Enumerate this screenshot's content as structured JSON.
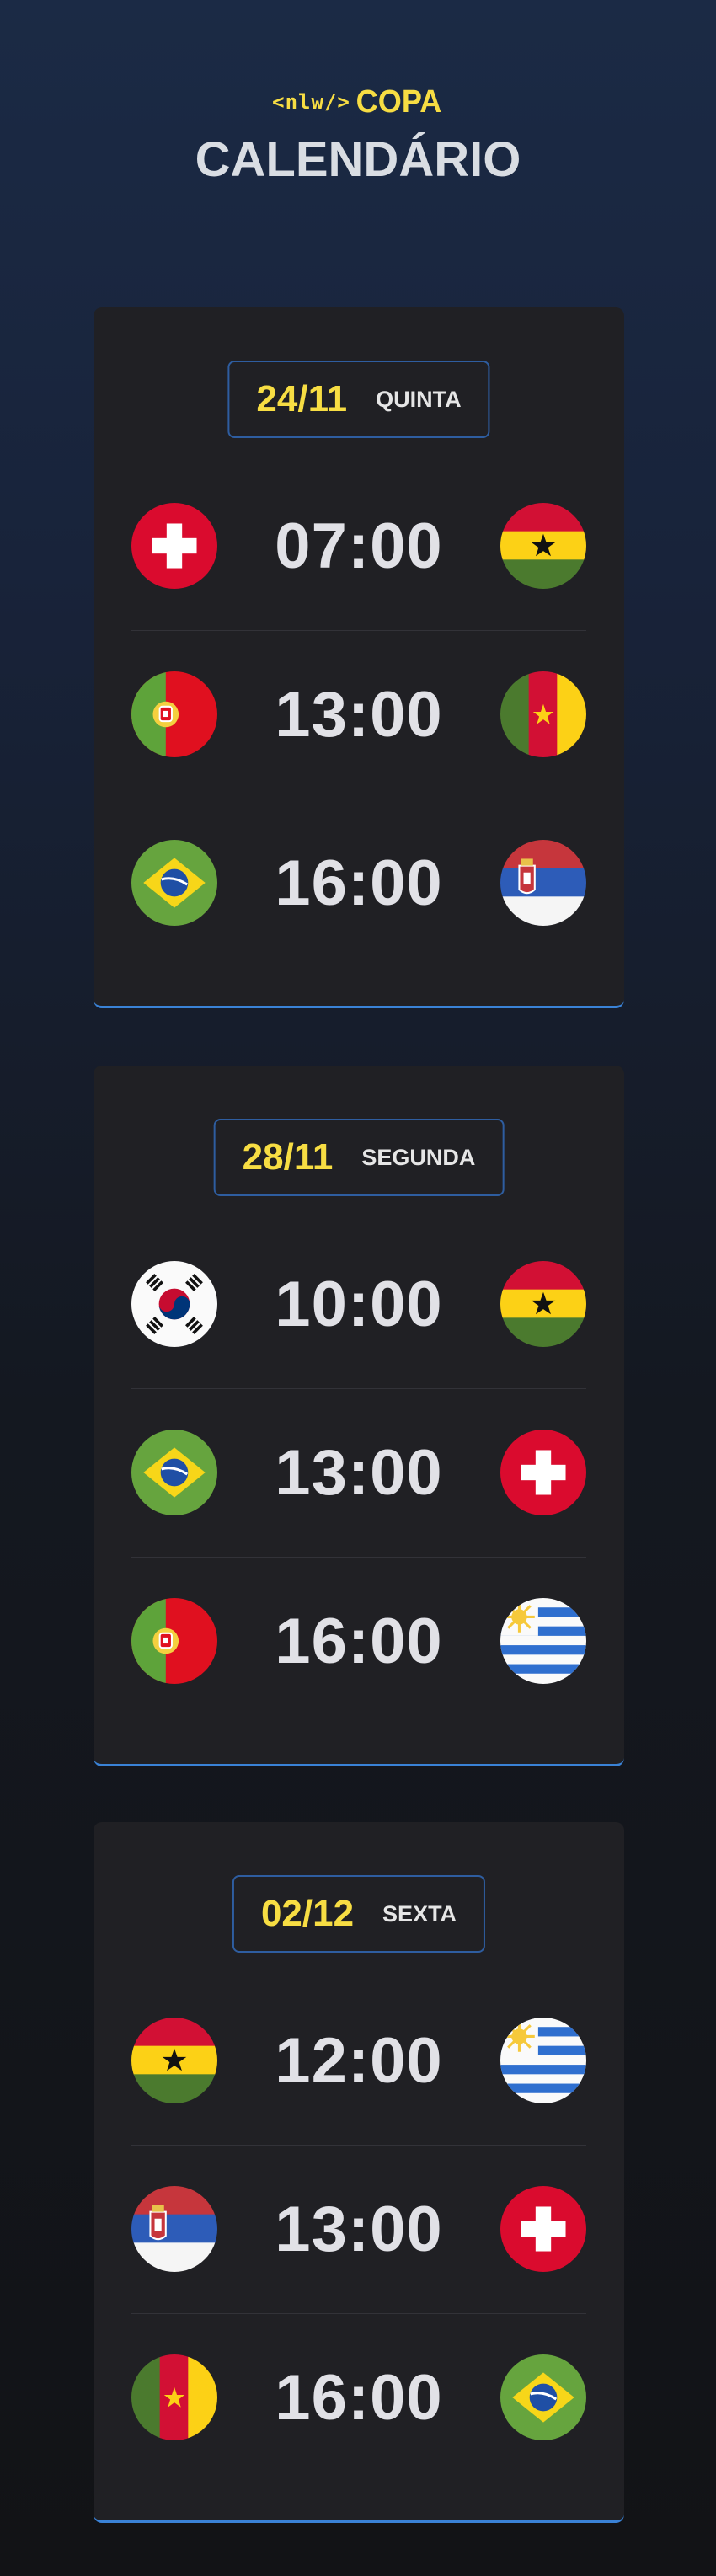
{
  "header": {
    "logo_tag": "<nlw/>",
    "logo_word": "COPA",
    "title": "CALENDÁRIO"
  },
  "colors": {
    "accent_yellow": "#f7dd43",
    "card_bg": "#202024",
    "card_border": "#3a82d6"
  },
  "days": [
    {
      "date": "24/11",
      "weekday": "QUINTA",
      "matches": [
        {
          "home": "switzerland-flag-icon",
          "time": "07:00",
          "away": "ghana-flag-icon"
        },
        {
          "home": "portugal-flag-icon",
          "time": "13:00",
          "away": "cameroon-flag-icon"
        },
        {
          "home": "brazil-flag-icon",
          "time": "16:00",
          "away": "serbia-flag-icon"
        }
      ]
    },
    {
      "date": "28/11",
      "weekday": "SEGUNDA",
      "matches": [
        {
          "home": "south-korea-flag-icon",
          "time": "10:00",
          "away": "ghana-flag-icon"
        },
        {
          "home": "brazil-flag-icon",
          "time": "13:00",
          "away": "switzerland-flag-icon"
        },
        {
          "home": "portugal-flag-icon",
          "time": "16:00",
          "away": "uruguay-flag-icon"
        }
      ]
    },
    {
      "date": "02/12",
      "weekday": "SEXTA",
      "matches": [
        {
          "home": "ghana-flag-icon",
          "time": "12:00",
          "away": "uruguay-flag-icon"
        },
        {
          "home": "serbia-flag-icon",
          "time": "13:00",
          "away": "switzerland-flag-icon"
        },
        {
          "home": "cameroon-flag-icon",
          "time": "16:00",
          "away": "brazil-flag-icon"
        }
      ]
    }
  ]
}
